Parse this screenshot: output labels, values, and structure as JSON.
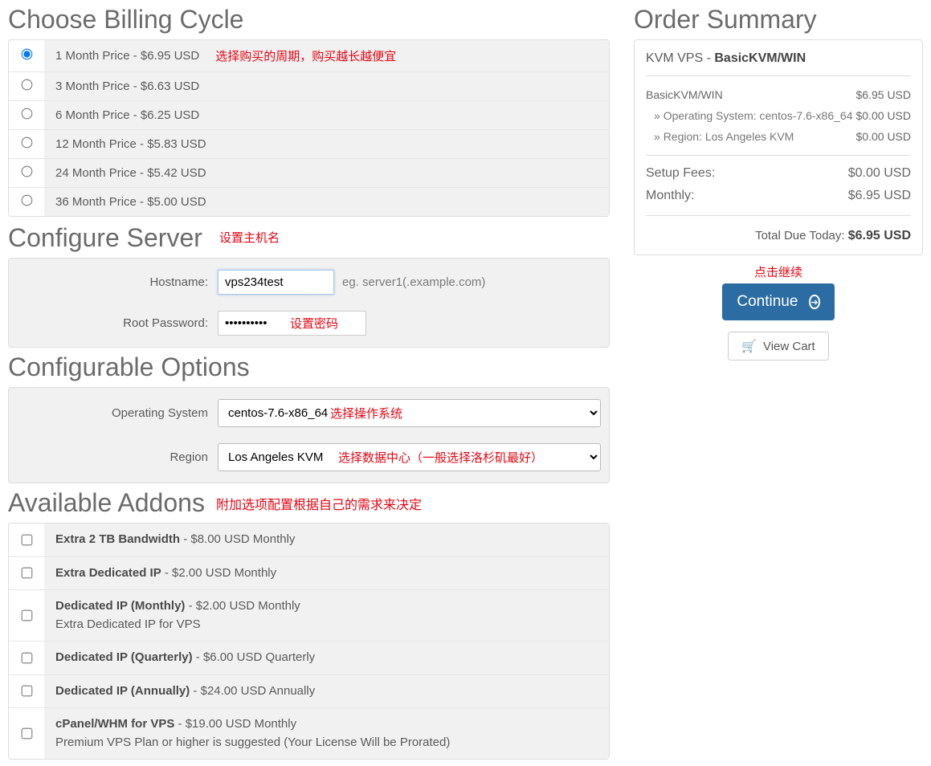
{
  "billing": {
    "title": "Choose Billing Cycle",
    "annotation": "选择购买的周期，购买越长越便宜",
    "options": [
      {
        "label": "1 Month Price - $6.95 USD",
        "selected": true
      },
      {
        "label": "3 Month Price - $6.63 USD",
        "selected": false
      },
      {
        "label": "6 Month Price - $6.25 USD",
        "selected": false
      },
      {
        "label": "12 Month Price - $5.83 USD",
        "selected": false
      },
      {
        "label": "24 Month Price - $5.42 USD",
        "selected": false
      },
      {
        "label": "36 Month Price - $5.00 USD",
        "selected": false
      }
    ]
  },
  "configure": {
    "title": "Configure Server",
    "hostname_label": "Hostname:",
    "hostname_value": "vps234test",
    "hostname_hint": "eg. server1(.example.com)",
    "hostname_annotation": "设置主机名",
    "rootpw_label": "Root Password:",
    "rootpw_value": "••••••••••",
    "rootpw_annotation": "设置密码"
  },
  "options": {
    "title": "Configurable Options",
    "os_label": "Operating System",
    "os_value": "centos-7.6-x86_64",
    "os_annotation": "选择操作系统",
    "region_label": "Region",
    "region_value": "Los Angeles KVM",
    "region_annotation": "选择数据中心（一般选择洛杉矶最好）"
  },
  "addons": {
    "title": "Available Addons",
    "annotation": "附加选项配置根据自己的需求来决定",
    "items": [
      {
        "name": "Extra 2 TB Bandwidth",
        "price": " - $8.00 USD Monthly",
        "desc": ""
      },
      {
        "name": "Extra Dedicated IP",
        "price": " - $2.00 USD Monthly",
        "desc": ""
      },
      {
        "name": "Dedicated IP (Monthly)",
        "price": " - $2.00 USD Monthly",
        "desc": "Extra Dedicated IP for VPS"
      },
      {
        "name": "Dedicated IP (Quarterly)",
        "price": " - $6.00 USD Quarterly",
        "desc": ""
      },
      {
        "name": "Dedicated IP (Annually)",
        "price": " - $24.00 USD Annually",
        "desc": ""
      },
      {
        "name": "cPanel/WHM for VPS",
        "price": " - $19.00 USD Monthly",
        "desc": "Premium VPS Plan or higher is suggested (Your License Will be Prorated)"
      }
    ]
  },
  "summary": {
    "title": "Order Summary",
    "product_prefix": "KVM VPS - ",
    "product_name": "BasicKVM/WIN",
    "lines": [
      {
        "label": "BasicKVM/WIN",
        "price": "$6.95 USD",
        "sub": false
      },
      {
        "label": "Operating System: centos-7.6-x86_64",
        "price": "$0.00 USD",
        "sub": true
      },
      {
        "label": "Region: Los Angeles KVM",
        "price": "$0.00 USD",
        "sub": true
      }
    ],
    "fees": [
      {
        "label": "Setup Fees:",
        "price": "$0.00 USD"
      },
      {
        "label": "Monthly:",
        "price": "$6.95 USD"
      }
    ],
    "total_label": "Total Due Today: ",
    "total_value": "$6.95 USD",
    "continue_label": "Continue",
    "continue_annotation": "点击继续",
    "viewcart_label": "View Cart"
  }
}
